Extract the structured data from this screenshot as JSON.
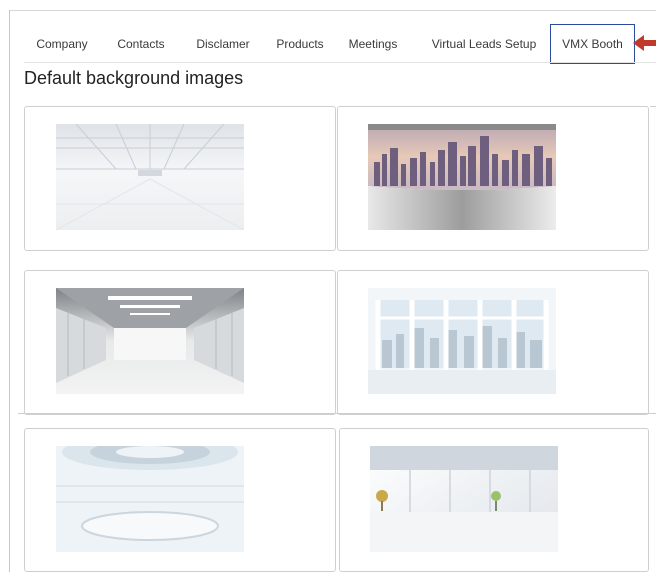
{
  "tabs": [
    {
      "label": "Company"
    },
    {
      "label": "Contacts"
    },
    {
      "label": "Disclamer"
    },
    {
      "label": "Products"
    },
    {
      "label": "Meetings"
    },
    {
      "label": "Virtual Leads Setup"
    },
    {
      "label": "VMX Booth",
      "active": true
    }
  ],
  "section": {
    "title": "Default background images"
  },
  "images": [
    {
      "icon": "warehouse-hall-image"
    },
    {
      "icon": "city-skyline-panorama-image"
    },
    {
      "icon": "white-corridor-image"
    },
    {
      "icon": "window-city-view-image"
    },
    {
      "icon": "circular-futuristic-room-image"
    },
    {
      "icon": "bright-office-image"
    }
  ],
  "colors": {
    "active_tab_border": "#2d4b9e",
    "annotation_arrow": "#c0392b",
    "card_border": "#cfcfcf"
  }
}
